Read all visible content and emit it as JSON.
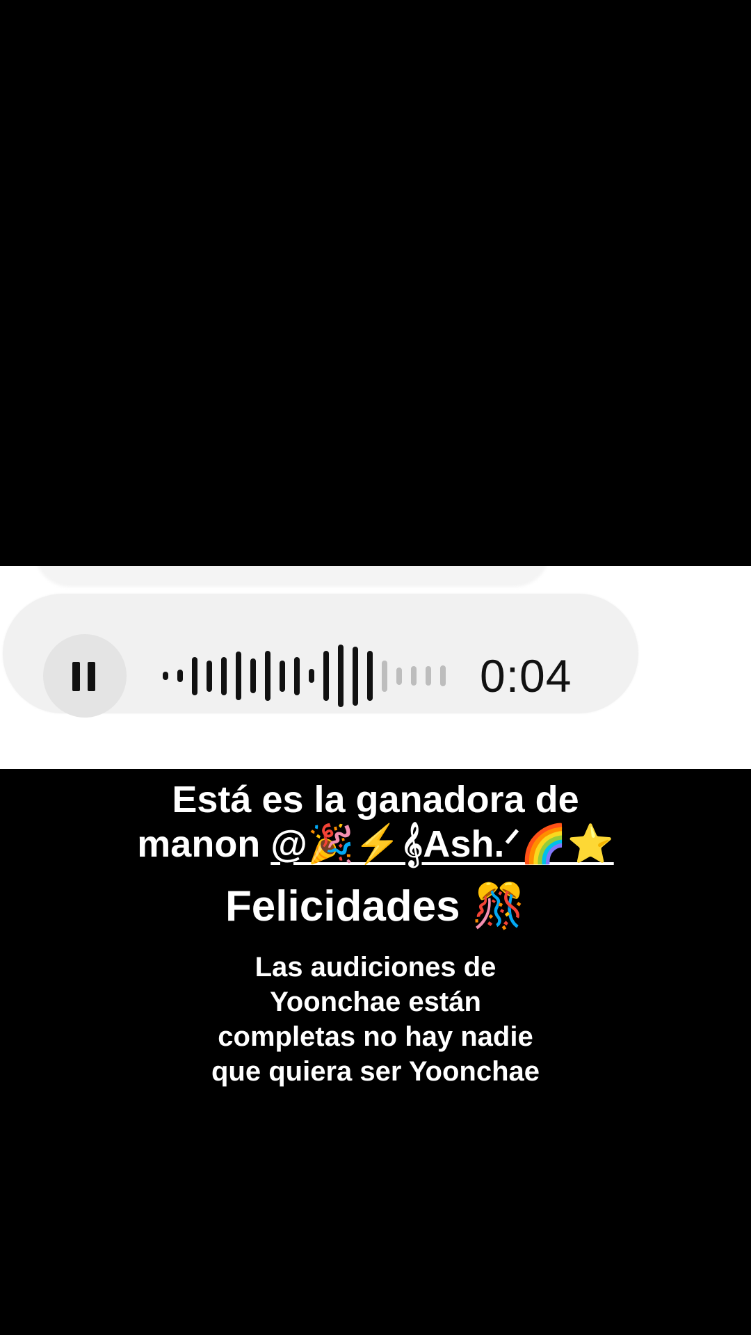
{
  "voice_message": {
    "duration": "0:04",
    "pause_icon": "pause-icon",
    "waveform_played_heights": [
      0.12,
      0.18,
      0.55,
      0.45,
      0.55,
      0.7,
      0.5,
      0.72,
      0.45,
      0.55,
      0.2,
      0.72,
      0.9,
      0.85,
      0.72
    ],
    "waveform_unplayed_heights": [
      0.45,
      0.25,
      0.28,
      0.28,
      0.3
    ],
    "played_color": "#111111",
    "unplayed_color": "#bdbdbd"
  },
  "caption": {
    "line1": "Está es la ganadora de",
    "line2_prefix": "manon ",
    "mention": "@🎉⚡𝄞Ash.ᐟ🌈⭐",
    "line3": "Felicidades 🎊",
    "sub_line1": "Las audiciones de",
    "sub_line2": "Yoonchae están",
    "sub_line3": "completas no hay nadie",
    "sub_line4": "que quiera ser Yoonchae"
  }
}
